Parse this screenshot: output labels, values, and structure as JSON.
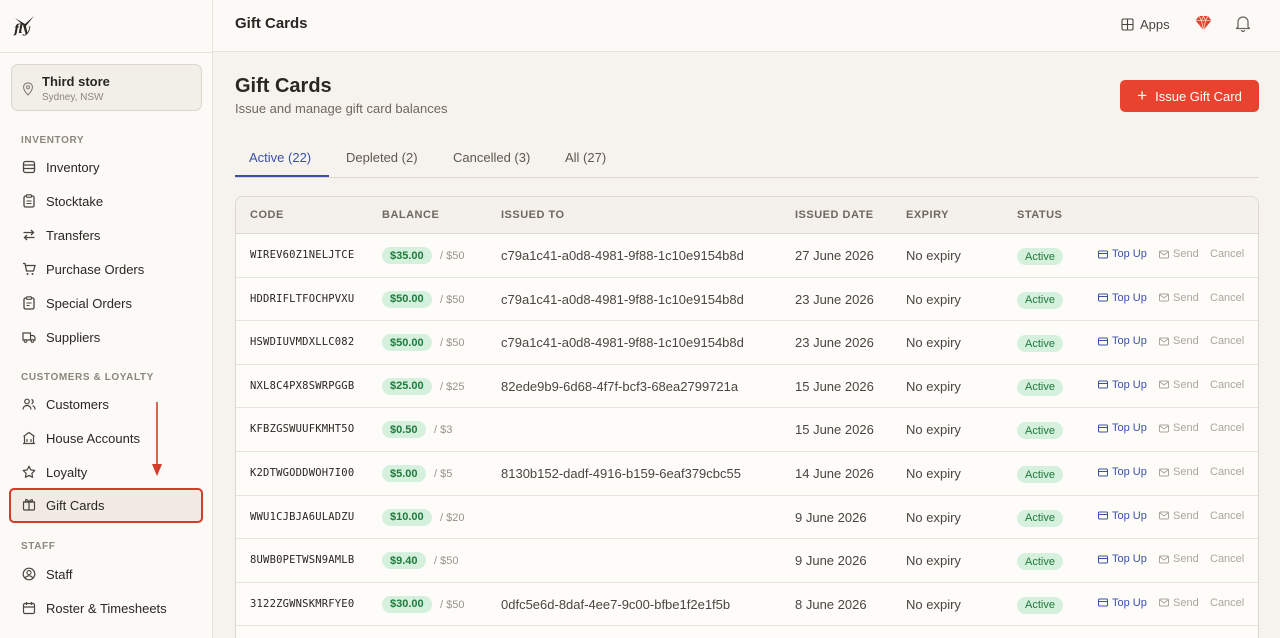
{
  "brand": {
    "logo_text": "fly"
  },
  "store": {
    "name": "Third store",
    "location": "Sydney, NSW"
  },
  "sidebar": {
    "sections": [
      {
        "label": "INVENTORY",
        "items": [
          "Inventory",
          "Stocktake",
          "Transfers",
          "Purchase Orders",
          "Special Orders",
          "Suppliers"
        ]
      },
      {
        "label": "CUSTOMERS & LOYALTY",
        "items": [
          "Customers",
          "House Accounts",
          "Loyalty",
          "Gift Cards"
        ]
      },
      {
        "label": "STAFF",
        "items": [
          "Staff",
          "Roster & Timesheets"
        ]
      }
    ],
    "active_item": "Gift Cards"
  },
  "topbar": {
    "title": "Gift Cards",
    "apps_label": "Apps"
  },
  "page": {
    "title": "Gift Cards",
    "subtitle": "Issue and manage gift card balances",
    "issue_button": "Issue Gift Card"
  },
  "tabs": [
    "Active (22)",
    "Depleted (2)",
    "Cancelled (3)",
    "All (27)"
  ],
  "table": {
    "headers": [
      "CODE",
      "BALANCE",
      "ISSUED TO",
      "ISSUED DATE",
      "EXPIRY",
      "STATUS"
    ],
    "actions": {
      "topup": "Top Up",
      "send": "Send",
      "cancel": "Cancel"
    },
    "rows": [
      {
        "code": "WIREV60Z1NELJTCE",
        "balance": "$35.00",
        "of": "/ $50",
        "issued_to": "c79a1c41-a0d8-4981-9f88-1c10e9154b8d",
        "date": "27 June 2026",
        "expiry": "No expiry",
        "status": "Active"
      },
      {
        "code": "HDDRIFLTFOCHPVXU",
        "balance": "$50.00",
        "of": "/ $50",
        "issued_to": "c79a1c41-a0d8-4981-9f88-1c10e9154b8d",
        "date": "23 June 2026",
        "expiry": "No expiry",
        "status": "Active"
      },
      {
        "code": "HSWDIUVMDXLLC082",
        "balance": "$50.00",
        "of": "/ $50",
        "issued_to": "c79a1c41-a0d8-4981-9f88-1c10e9154b8d",
        "date": "23 June 2026",
        "expiry": "No expiry",
        "status": "Active"
      },
      {
        "code": "NXL8C4PX8SWRPGGB",
        "balance": "$25.00",
        "of": "/ $25",
        "issued_to": "82ede9b9-6d68-4f7f-bcf3-68ea2799721a",
        "date": "15 June 2026",
        "expiry": "No expiry",
        "status": "Active"
      },
      {
        "code": "KFBZGSWUUFKMHT5O",
        "balance": "$0.50",
        "of": "/ $3",
        "issued_to": "",
        "date": "15 June 2026",
        "expiry": "No expiry",
        "status": "Active"
      },
      {
        "code": "K2DTWGODDWOH7I00",
        "balance": "$5.00",
        "of": "/ $5",
        "issued_to": "8130b152-dadf-4916-b159-6eaf379cbc55",
        "date": "14 June 2026",
        "expiry": "No expiry",
        "status": "Active"
      },
      {
        "code": "WWU1CJBJA6ULADZU",
        "balance": "$10.00",
        "of": "/ $20",
        "issued_to": "",
        "date": "9 June 2026",
        "expiry": "No expiry",
        "status": "Active"
      },
      {
        "code": "8UWB0PETWSN9AMLB",
        "balance": "$9.40",
        "of": "/ $50",
        "issued_to": "",
        "date": "9 June 2026",
        "expiry": "No expiry",
        "status": "Active"
      },
      {
        "code": "3122ZGWNSKMRFYE0",
        "balance": "$30.00",
        "of": "/ $50",
        "issued_to": "0dfc5e6d-8daf-4ee7-9c00-bfbe1f2e1f5b",
        "date": "8 June 2026",
        "expiry": "No expiry",
        "status": "Active"
      }
    ]
  },
  "colors": {
    "accent": "#e8432f",
    "link": "#3b50a8",
    "active_green": "#1f7a3c",
    "highlight": "#d63a2a"
  }
}
